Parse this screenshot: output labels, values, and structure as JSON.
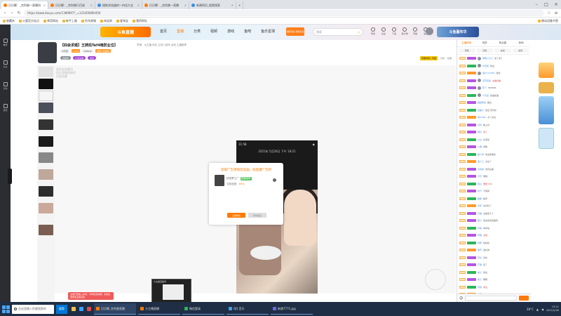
{
  "browser": {
    "tabs": [
      {
        "label": "贝贝椰：_克利普一直播间"
      },
      {
        "label": "贝贝椰：_克利普行目录"
      },
      {
        "label": "搜狗浏览器的—何化大全"
      },
      {
        "label": "贝贝椰：_克利普一直播"
      },
      {
        "label": "新建网页_搜索搜索"
      }
    ],
    "url": "https://www.douyu.com/1389897?_=123456890456",
    "bookmarks": [
      "收藏夹",
      "火狐官方站点",
      "常用网站",
      "新手上路",
      "京东商城",
      "淘宝网",
      "爱淘宝",
      "我的网址"
    ],
    "other_bookmarks": "移动设备书签"
  },
  "leftbar": {
    "items": [
      "推荐",
      "关注",
      "分类",
      "游戏"
    ]
  },
  "site": {
    "logo": "斗鱼直播",
    "nav": [
      "首页",
      "直播",
      "分类",
      "视频",
      "游戏",
      "鱼吧",
      "鱼乐星球"
    ],
    "promo": "领取现金 游戏礼包",
    "search_placeholder": "搜索",
    "icons": [
      "历史",
      "关注",
      "下载",
      "客户端",
      "开播",
      "消息"
    ],
    "banner": "斗鱼嘉年华"
  },
  "room": {
    "title": "【四会求婚】王牌局Tef4暗防业位】",
    "meta": "举报：大主播  综合 主持人游戏  活动  主播推荐",
    "tags": [
      "大巴娃",
      "6 Lv0",
      "198641 ",
      "荣耀人直播间"
    ],
    "buttons": [
      "直播间",
      "认证主播"
    ],
    "follow": "关注",
    "share": "分享",
    "gift": "礼物",
    "badge": "高能时刻 | 乐园"
  },
  "player": {
    "overlay": "星辰加直播间\n团队荣耀直播间\n回放直播",
    "phone_time": "11:58",
    "phone_date": "2021年 5月26日 下午 18:21",
    "popup": {
      "title": "您刚广告弹窗您加油，就直播广告吧",
      "line1": "铃花梦工厂",
      "tag": "直播推荐",
      "line2_label": "当前进度：",
      "line2_value": "85%",
      "confirm": "立即前往",
      "cancel": "暂时跳过"
    },
    "toast": "主播已经加入房间，可参加活动哦！点击这里参加主播活动",
    "mini_title": "大主播直播间"
  },
  "chat": {
    "tabs": [
      "主播榜单",
      "贵宾",
      "粉丝团",
      "房间"
    ],
    "rank": [
      "周榜",
      "日榜",
      "在线",
      "房管"
    ],
    "messages": [
      {
        "user": "弹幕小王子",
        "text": "来了来了"
      },
      {
        "user": "长安客",
        "text": "欢迎"
      },
      {
        "user": "用户123456",
        "text": "哈哈"
      },
      {
        "user": "花开富贵",
        "text": "主播好看"
      },
      {
        "user": "阿飞",
        "text": "666666"
      },
      {
        "user": "小可爱",
        "text": "加油加油"
      },
      {
        "user": "超级粉丝",
        "text": "路过"
      },
      {
        "user": "夜猫子",
        "text": "送出 荧光棒"
      },
      {
        "user": "用户ABC",
        "text": "点个关注"
      },
      {
        "user": "清风",
        "text": "晚上好"
      },
      {
        "user": "明月",
        "text": "来了"
      },
      {
        "user": "大白",
        "text": "好漂亮"
      },
      {
        "user": "小黑",
        "text": "求歌"
      },
      {
        "user": "路人甲",
        "text": "欢迎新朋友"
      },
      {
        "user": "路人乙",
        "text": "关注了"
      },
      {
        "user": "冰淇淋",
        "text": "支持主播"
      },
      {
        "user": "可乐",
        "text": "嘿嘿"
      },
      {
        "user": "西瓜",
        "text": "赠送 520"
      },
      {
        "user": "饼干",
        "text": "不容易"
      },
      {
        "user": "糖果",
        "text": "晚安"
      },
      {
        "user": "奶茶",
        "text": "太好听了"
      },
      {
        "user": "汉堡",
        "text": "主播多大了"
      },
      {
        "user": "橙子",
        "text": "欢迎来到直播间"
      },
      {
        "user": "柠檬",
        "text": "棒棒哒"
      },
      {
        "user": "苹果",
        "text": "点赞"
      },
      {
        "user": "香蕉",
        "text": "哈哈哈"
      },
      {
        "user": "葡萄",
        "text": "送礼物"
      },
      {
        "user": "草莓",
        "text": "好听"
      },
      {
        "user": "芒果",
        "text": "来了"
      },
      {
        "user": "桃子",
        "text": "欢迎"
      },
      {
        "user": "梨子",
        "text": "嗯嗯"
      },
      {
        "user": "荔枝",
        "text": "关注"
      },
      {
        "user": "龙眼",
        "text": "666"
      }
    ]
  },
  "taskbar": {
    "search_placeholder": "在这里输入你要搜索的",
    "go": "搜索",
    "windows": [
      "贝贝椰_克利普直播",
      "大主播直播",
      "微信登录",
      "QQ 音乐",
      "新建7771.jpg"
    ],
    "tray_temp": "28°C",
    "time": "13:21",
    "date": "2021/5/26"
  }
}
